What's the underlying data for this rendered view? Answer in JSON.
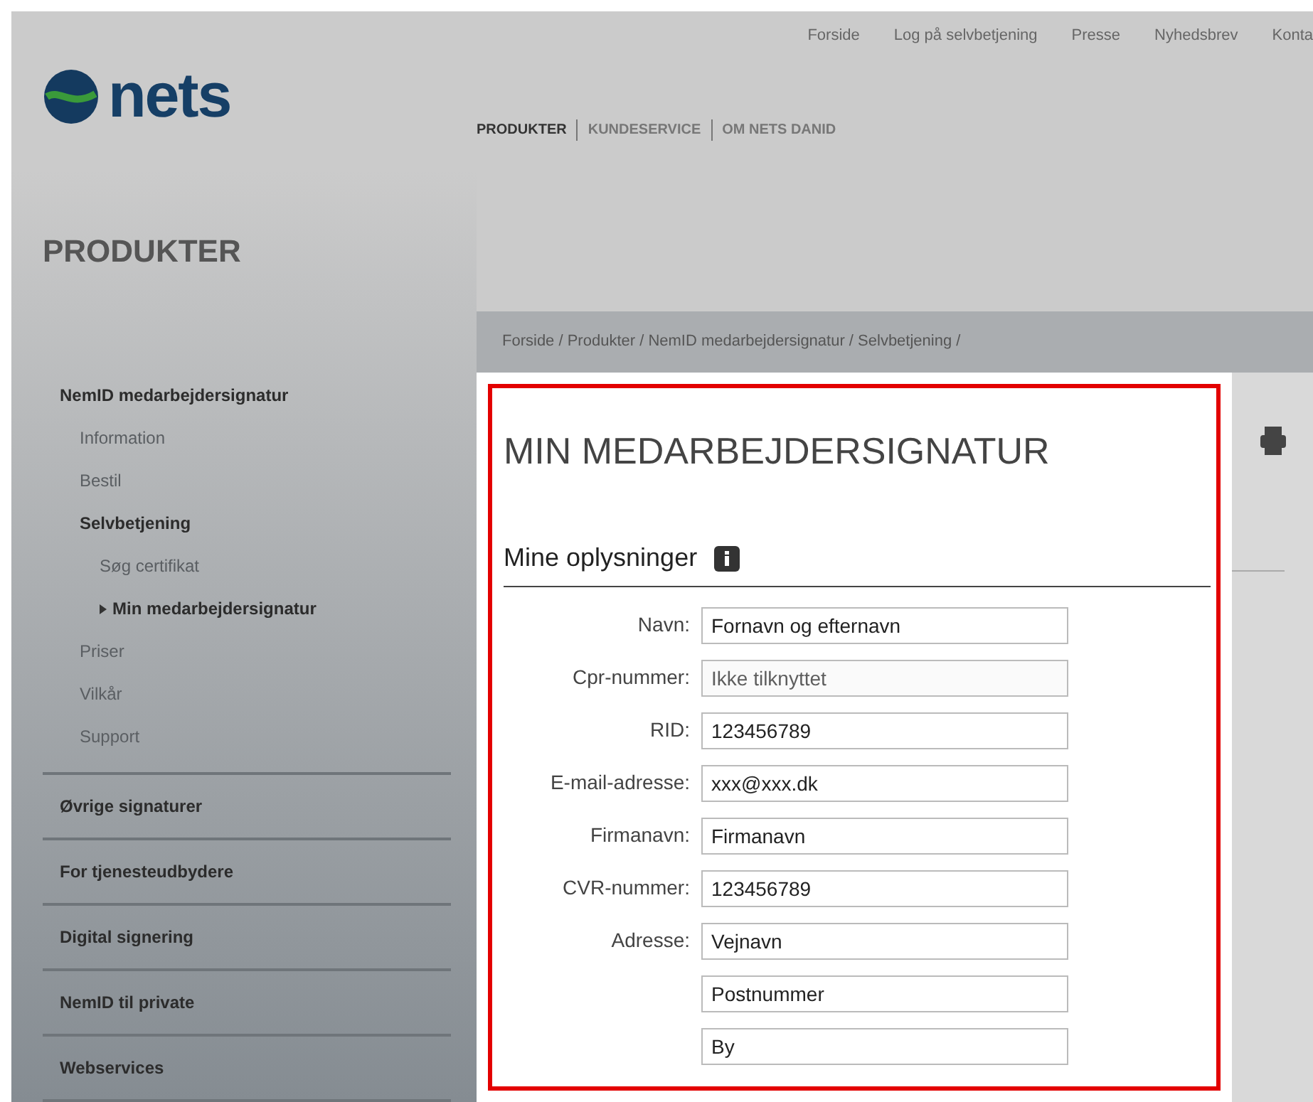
{
  "top_links": [
    "Forside",
    "Log på selvbetjening",
    "Presse",
    "Nyhedsbrev",
    "Konta"
  ],
  "logo": {
    "text": "nets"
  },
  "main_nav": [
    {
      "label": "PRODUKTER",
      "selected": true
    },
    {
      "label": "KUNDESERVICE",
      "selected": false
    },
    {
      "label": "OM NETS DANID",
      "selected": false
    }
  ],
  "section_title": "PRODUKTER",
  "sidebar": {
    "items": [
      {
        "label": "NemID medarbejdersignatur",
        "selected": false,
        "expanded": true,
        "children": [
          {
            "label": "Information",
            "selected": false
          },
          {
            "label": "Bestil",
            "selected": false
          },
          {
            "label": "Selvbetjening",
            "selected": false,
            "expanded": true,
            "children": [
              {
                "label": "Søg certifikat",
                "selected": false
              },
              {
                "label": "Min medarbejdersignatur",
                "selected": true
              }
            ]
          },
          {
            "label": "Priser",
            "selected": false
          },
          {
            "label": "Vilkår",
            "selected": false
          },
          {
            "label": "Support",
            "selected": false
          }
        ]
      },
      {
        "label": "Øvrige signaturer",
        "selected": false,
        "expanded": false
      },
      {
        "label": "For tjenesteudbydere",
        "selected": false,
        "expanded": false
      },
      {
        "label": "Digital signering",
        "selected": false,
        "expanded": false
      },
      {
        "label": "NemID til private",
        "selected": false,
        "expanded": false
      },
      {
        "label": "Webservices",
        "selected": false,
        "expanded": false
      }
    ]
  },
  "breadcrumb": "Forside / Produkter / NemID medarbejdersignatur / Selvbetjening /",
  "page_title": "MIN MEDARBEJDERSIGNATUR",
  "section_heading": "Mine oplysninger",
  "fields": [
    {
      "label": "Navn:",
      "value": "Fornavn og efternavn",
      "disabled": false
    },
    {
      "label": "Cpr-nummer:",
      "value": "Ikke tilknyttet",
      "disabled": true
    },
    {
      "label": "RID:",
      "value": "123456789",
      "disabled": false
    },
    {
      "label": "E-mail-adresse:",
      "value": "xxx@xxx.dk",
      "disabled": false
    },
    {
      "label": "Firmanavn:",
      "value": "Firmanavn",
      "disabled": false
    },
    {
      "label": "CVR-nummer:",
      "value": "123456789",
      "disabled": false
    },
    {
      "label": "Adresse:",
      "value": "Vejnavn",
      "disabled": false
    },
    {
      "value": "Postnummer",
      "disabled": false
    },
    {
      "value": "By",
      "disabled": false
    }
  ]
}
